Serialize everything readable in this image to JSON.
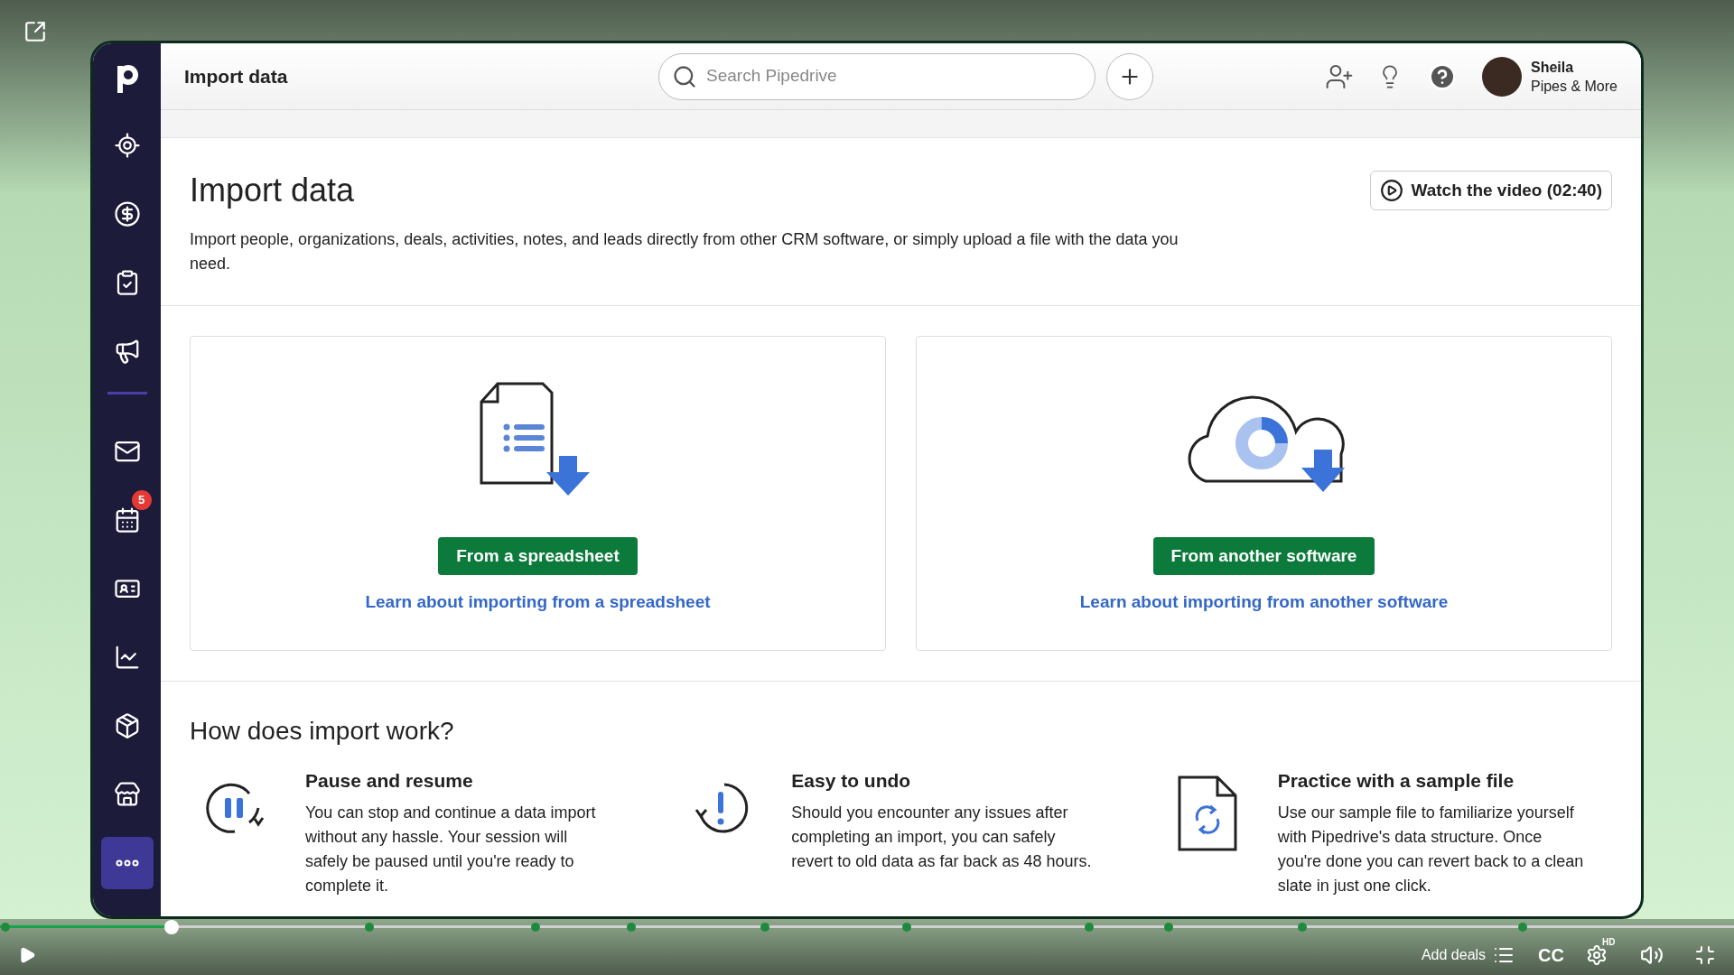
{
  "app": {
    "page_title": "Import data",
    "search": {
      "placeholder": "Search Pipedrive"
    },
    "user": {
      "name": "Sheila",
      "company": "Pipes & More"
    }
  },
  "sidebar": {
    "items": [
      {
        "kind": "target"
      },
      {
        "kind": "deals"
      },
      {
        "kind": "tasks"
      },
      {
        "kind": "campaigns"
      },
      {
        "kind": "divider"
      },
      {
        "kind": "mail"
      },
      {
        "kind": "calendar",
        "badge": "5"
      },
      {
        "kind": "contacts"
      },
      {
        "kind": "insights"
      },
      {
        "kind": "products"
      },
      {
        "kind": "store"
      },
      {
        "kind": "more"
      }
    ]
  },
  "content": {
    "heading": "Import data",
    "watch_button": "Watch the video (02:40)",
    "description": "Import people, organizations, deals, activities, notes, and leads directly from other CRM software, or simply upload a file with the data you need.",
    "options": [
      {
        "kind": "spreadsheet",
        "button": "From a spreadsheet",
        "link": "Learn about importing from a spreadsheet"
      },
      {
        "kind": "software",
        "button": "From another software",
        "link": "Learn about importing from another software"
      }
    ],
    "how": {
      "heading": "How does import work?",
      "features": [
        {
          "kind": "pause",
          "title": "Pause and resume",
          "text": "You can stop and continue a data import without any hassle. Your session will safely be paused until you're ready to complete it."
        },
        {
          "kind": "undo",
          "title": "Easy to undo",
          "text": "Should you encounter any issues after completing an import, you can safely revert to old data as far back as 48 hours."
        },
        {
          "kind": "sample",
          "title": "Practice with a sample file",
          "text": "Use our sample file to familiarize yourself with Pipedrive's data structure. Once you're done you can revert back to a clean slate in just one click."
        }
      ]
    }
  },
  "video": {
    "level": 0.099,
    "add_deals": "Add deals",
    "cc": "CC",
    "hd": "HD"
  }
}
